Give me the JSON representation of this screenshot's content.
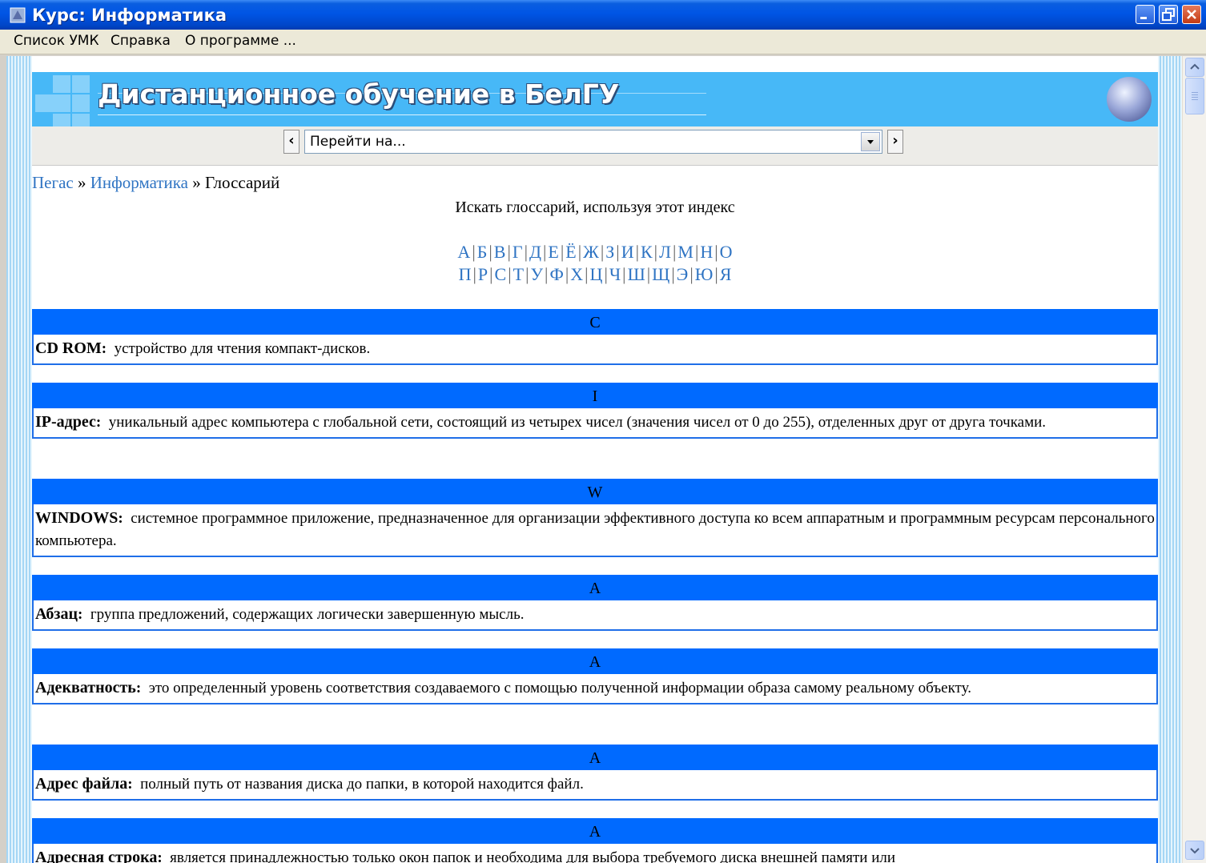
{
  "window": {
    "title": "Курс: Информатика"
  },
  "menu": {
    "items": [
      "Список УМК",
      "Справка",
      "О программе ..."
    ]
  },
  "banner": {
    "title": "Дистанционное обучение в БелГУ"
  },
  "nav": {
    "prev_label": "‹",
    "next_label": "›",
    "jump_placeholder": "Перейти на..."
  },
  "breadcrumb": {
    "items": [
      "Пегас",
      "Информатика",
      "Глоссарий"
    ],
    "separator": "»"
  },
  "glossary": {
    "search_hint": "Искать глоссарий, используя этот индекс",
    "index_row1": [
      "А",
      "Б",
      "В",
      "Г",
      "Д",
      "Е",
      "Ё",
      "Ж",
      "З",
      "И",
      "К",
      "Л",
      "М",
      "Н",
      "О"
    ],
    "index_row2": [
      "П",
      "Р",
      "С",
      "Т",
      "У",
      "Ф",
      "Х",
      "Ц",
      "Ч",
      "Ш",
      "Щ",
      "Э",
      "Ю",
      "Я"
    ],
    "entries": [
      {
        "letter": "C",
        "term": "CD ROM",
        "definition": "устройство для чтения компакт-дисков."
      },
      {
        "letter": "I",
        "term": "IP-адрес",
        "definition": "уникальный адрес компьютера с глобальной сети, состоящий из четырех чисел (значения чисел от 0 до 255), отделенных друг от друга точками."
      },
      {
        "letter": "W",
        "term": "WINDOWS",
        "definition": "системное программное приложение, предназначенное для организации эффективного доступа ко всем аппаратным и программным ресурсам персонального компьютера."
      },
      {
        "letter": "А",
        "term": "Абзац",
        "definition": "группа предложений, содержащих логически завершенную мысль."
      },
      {
        "letter": "А",
        "term": "Адекватность",
        "definition": "это определенный уровень соответствия создаваемого с помощью полученной информации образа самому реальному объекту."
      },
      {
        "letter": "А",
        "term": "Адрес файла",
        "definition": "полный путь от названия диска до папки, в которой находится файл."
      },
      {
        "letter": "А",
        "term": "Адресная строка",
        "definition": "является принадлежностью только окон папок и необходима для выбора требуемого диска внешней памяти или"
      }
    ]
  },
  "colors": {
    "titlebar": "#0055e5",
    "banner": "#47b8f7",
    "entry_header": "#006aff",
    "link": "#2f74c3"
  }
}
